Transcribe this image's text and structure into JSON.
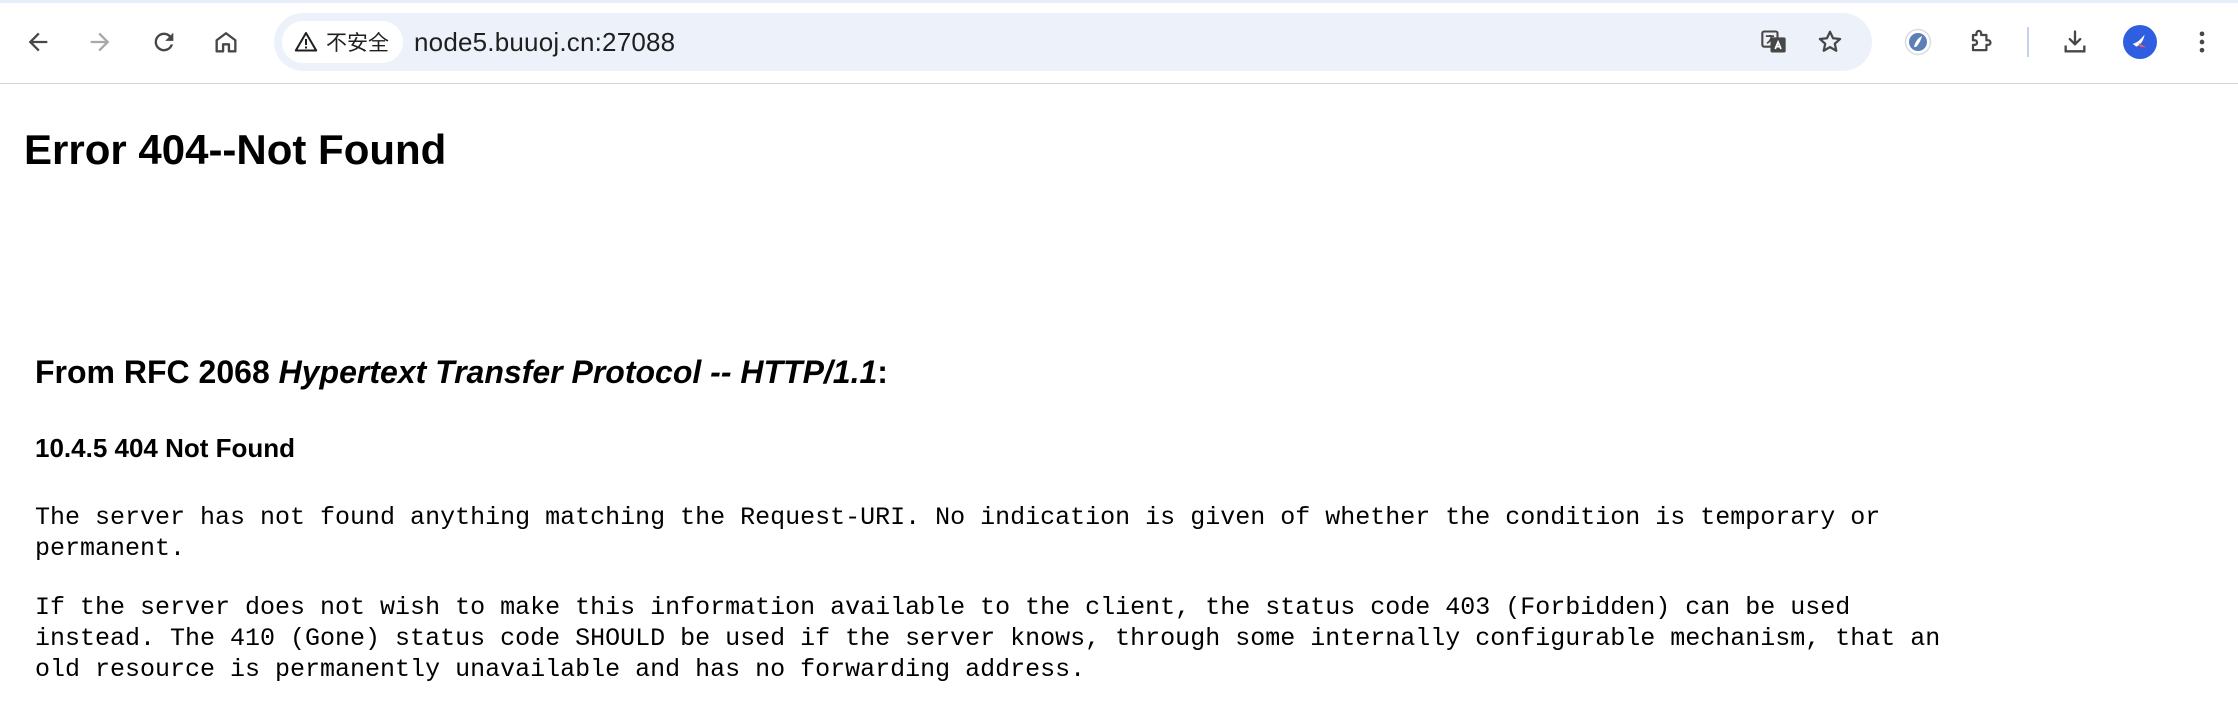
{
  "browser": {
    "security_label": "不安全",
    "url": "node5.buuoj.cn:27088",
    "accent_color": "#2f5fe0"
  },
  "page": {
    "title": "Error 404--Not Found",
    "rfc_prefix": "From RFC 2068 ",
    "rfc_title": "Hypertext Transfer Protocol -- HTTP/1.1",
    "rfc_suffix": ":",
    "section_heading": "10.4.5 404 Not Found",
    "paragraph1_line1": "The server has not found anything matching the Request-URI. No indication is given of whether the condition is temporary or",
    "paragraph1_line2": "permanent.",
    "paragraph2_line1": "If the server does not wish to make this information available to the client, the status code 403 (Forbidden) can be used",
    "paragraph2_line2": "instead. The 410 (Gone) status code SHOULD be used if the server knows, through some internally configurable mechanism, that an",
    "paragraph2_line3": "old resource is permanently unavailable and has no forwarding address."
  }
}
